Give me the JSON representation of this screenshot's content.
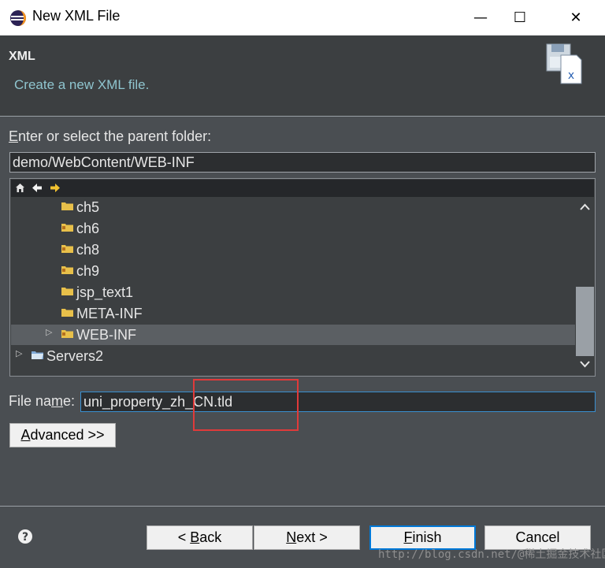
{
  "window": {
    "title": "New XML File",
    "minimize_glyph": "—",
    "maximize_glyph": "☐",
    "close_glyph": "✕"
  },
  "banner": {
    "title": "XML",
    "description": "Create a new XML file."
  },
  "parent_folder": {
    "label_mnemonic": "E",
    "label_rest": "nter or select the parent folder:",
    "value": "demo/WebContent/WEB-INF"
  },
  "tree": {
    "toolbar_icons": [
      "home-icon",
      "back-arrow-icon",
      "forward-arrow-icon"
    ],
    "items": [
      {
        "label": "ch5",
        "icon": "folder-icon"
      },
      {
        "label": "ch6",
        "icon": "package-folder-icon"
      },
      {
        "label": "ch8",
        "icon": "package-folder-icon"
      },
      {
        "label": "ch9",
        "icon": "package-folder-icon"
      },
      {
        "label": "jsp_text1",
        "icon": "folder-icon"
      },
      {
        "label": "META-INF",
        "icon": "folder-icon"
      },
      {
        "label": "WEB-INF",
        "icon": "package-folder-icon",
        "selected": true,
        "expander": "▷"
      },
      {
        "label": "Servers2",
        "icon": "project-folder-icon",
        "expander": "▷"
      }
    ]
  },
  "file_name": {
    "label_before": "File na",
    "label_mnemonic": "m",
    "label_after": "e:",
    "value": "uni_property_zh_CN.tld"
  },
  "advanced_button": {
    "mnemonic": "A",
    "rest": "dvanced >>"
  },
  "footer": {
    "help_glyph": "?",
    "back": {
      "before": "< ",
      "mnemonic": "B",
      "after": "ack"
    },
    "next": {
      "mnemonic": "N",
      "after": "ext >"
    },
    "finish": {
      "mnemonic": "F",
      "after": "inish"
    },
    "cancel": "Cancel"
  },
  "watermark": "http://blog.csdn.net/@稀土掘金技术社区",
  "colors": {
    "accent": "#0078d7",
    "highlight_box": "#e03a3a",
    "banner_desc": "#8fc5cf",
    "folder_yellow": "#e8c04a"
  }
}
